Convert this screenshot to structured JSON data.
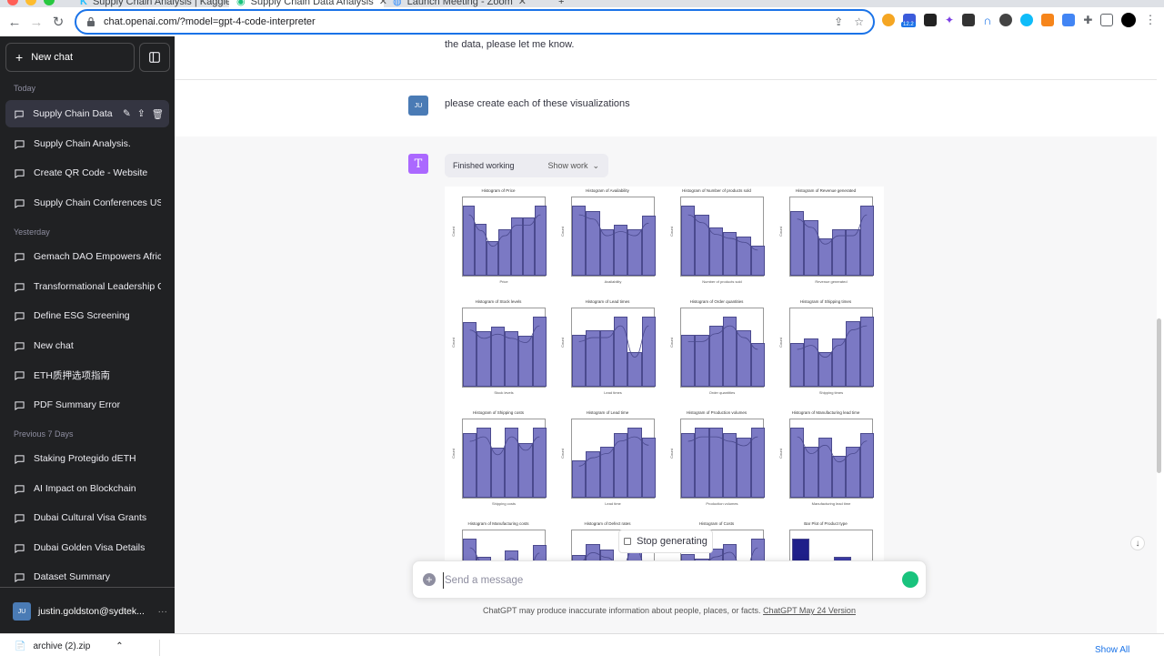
{
  "browser": {
    "tabs": [
      {
        "label": "Supply Chain Analysis | Kaggle"
      },
      {
        "label": "Supply Chain Data Analysis"
      },
      {
        "label": "Launch Meeting - Zoom"
      }
    ],
    "url": "chat.openai.com/?model=gpt-4-code-interpreter",
    "extension_badge": "12.2"
  },
  "sidebar": {
    "new_chat_label": "New chat",
    "sections": [
      {
        "label": "Today",
        "items": [
          "Supply Chain Data A",
          "Supply Chain Analysis.",
          "Create QR Code - Website",
          "Supply Chain Conferences US"
        ]
      },
      {
        "label": "Yesterday",
        "items": [
          "Gemach DAO Empowers Afric",
          "Transformational Leadership C",
          "Define ESG Screening",
          "New chat",
          "ETH质押选项指南",
          "PDF Summary Error"
        ]
      },
      {
        "label": "Previous 7 Days",
        "items": [
          "Staking Protegido dETH",
          "AI Impact on Blockchain",
          "Dubai Cultural Visa Grants",
          "Dubai Golden Visa Details",
          "Dataset Summary"
        ]
      }
    ],
    "user": {
      "initials": "JU",
      "email": "justin.goldston@sydtek..."
    }
  },
  "conversation": {
    "prev_text": "the data, please let me know.",
    "user_initials": "JU",
    "user_message": "please create each of these visualizations",
    "assistant_status": "Finished working",
    "show_work_label": "Show work",
    "assistant_icon_letter": "T"
  },
  "chart_data": [
    {
      "type": "bar",
      "title": "Histogram of Price",
      "xlabel": "Price",
      "ylabel": "Count",
      "values": [
        12,
        9,
        6,
        8,
        10,
        10,
        12
      ]
    },
    {
      "type": "bar",
      "title": "Histogram of Availability",
      "xlabel": "Availability",
      "ylabel": "Count",
      "values": [
        15,
        14,
        10,
        11,
        10,
        13
      ]
    },
    {
      "type": "bar",
      "title": "Histogram of Number of products sold",
      "xlabel": "Number of products sold",
      "ylabel": "Count",
      "values": [
        16,
        14,
        11,
        10,
        9,
        7
      ]
    },
    {
      "type": "bar",
      "title": "Histogram of Revenue generated",
      "xlabel": "Revenue generated",
      "ylabel": "Count",
      "values": [
        14,
        12,
        8,
        10,
        10,
        15
      ]
    },
    {
      "type": "bar",
      "title": "Histogram of Stock levels",
      "xlabel": "Stock levels",
      "ylabel": "Count",
      "values": [
        14,
        12,
        13,
        12,
        11,
        15
      ]
    },
    {
      "type": "bar",
      "title": "Histogram of Lead times",
      "xlabel": "Lead times",
      "ylabel": "Count",
      "values": [
        12,
        13,
        13,
        16,
        8,
        16
      ]
    },
    {
      "type": "bar",
      "title": "Histogram of Order quantities",
      "xlabel": "Order quantities",
      "ylabel": "Count",
      "values": [
        12,
        12,
        14,
        16,
        13,
        10
      ]
    },
    {
      "type": "bar",
      "title": "Histogram of Shipping times",
      "xlabel": "Shipping times",
      "ylabel": "Count",
      "values": [
        10,
        11,
        8,
        11,
        15,
        16
      ]
    },
    {
      "type": "bar",
      "title": "Histogram of Shipping costs",
      "xlabel": "Shipping costs",
      "ylabel": "Count",
      "values": [
        13,
        14,
        10,
        14,
        11,
        14
      ]
    },
    {
      "type": "bar",
      "title": "Histogram of Lead time",
      "xlabel": "Lead time",
      "ylabel": "Count",
      "values": [
        8,
        10,
        11,
        14,
        15,
        13
      ]
    },
    {
      "type": "bar",
      "title": "Histogram of Production volumes",
      "xlabel": "Production volumes",
      "ylabel": "Count",
      "values": [
        13,
        14,
        14,
        13,
        12,
        14
      ]
    },
    {
      "type": "bar",
      "title": "Histogram of Manufacturing lead time",
      "xlabel": "Manufacturing lead time",
      "ylabel": "Count",
      "values": [
        15,
        11,
        13,
        9,
        11,
        14
      ]
    },
    {
      "type": "bar",
      "title": "Histogram of Manufacturing costs",
      "xlabel": "",
      "ylabel": "",
      "values": [
        12,
        9,
        8,
        10,
        6,
        11
      ]
    },
    {
      "type": "bar",
      "title": "Histogram of Defect rates",
      "xlabel": "",
      "ylabel": "",
      "values": [
        10,
        12,
        11,
        9,
        13,
        8
      ]
    },
    {
      "type": "bar",
      "title": "Histogram of Costs",
      "xlabel": "",
      "ylabel": "",
      "values": [
        11,
        10,
        12,
        13,
        9,
        14
      ]
    },
    {
      "type": "bar",
      "title": "Bar Plot of Product type",
      "xlabel": "",
      "ylabel": "",
      "values": [
        40,
        0,
        30,
        0
      ]
    }
  ],
  "controls": {
    "stop_label": "Stop generating",
    "input_placeholder": "Send a message",
    "disclaimer": "ChatGPT may produce inaccurate information about people, places, or facts.",
    "version_link": "ChatGPT May 24 Version"
  },
  "downloads": {
    "file": "archive (2).zip",
    "show_all": "Show All"
  },
  "colors": {
    "bar": "#7b79c4",
    "bar_dark": "#1f1f8a",
    "accent": "#1a73e8",
    "sidebar": "#202123"
  }
}
